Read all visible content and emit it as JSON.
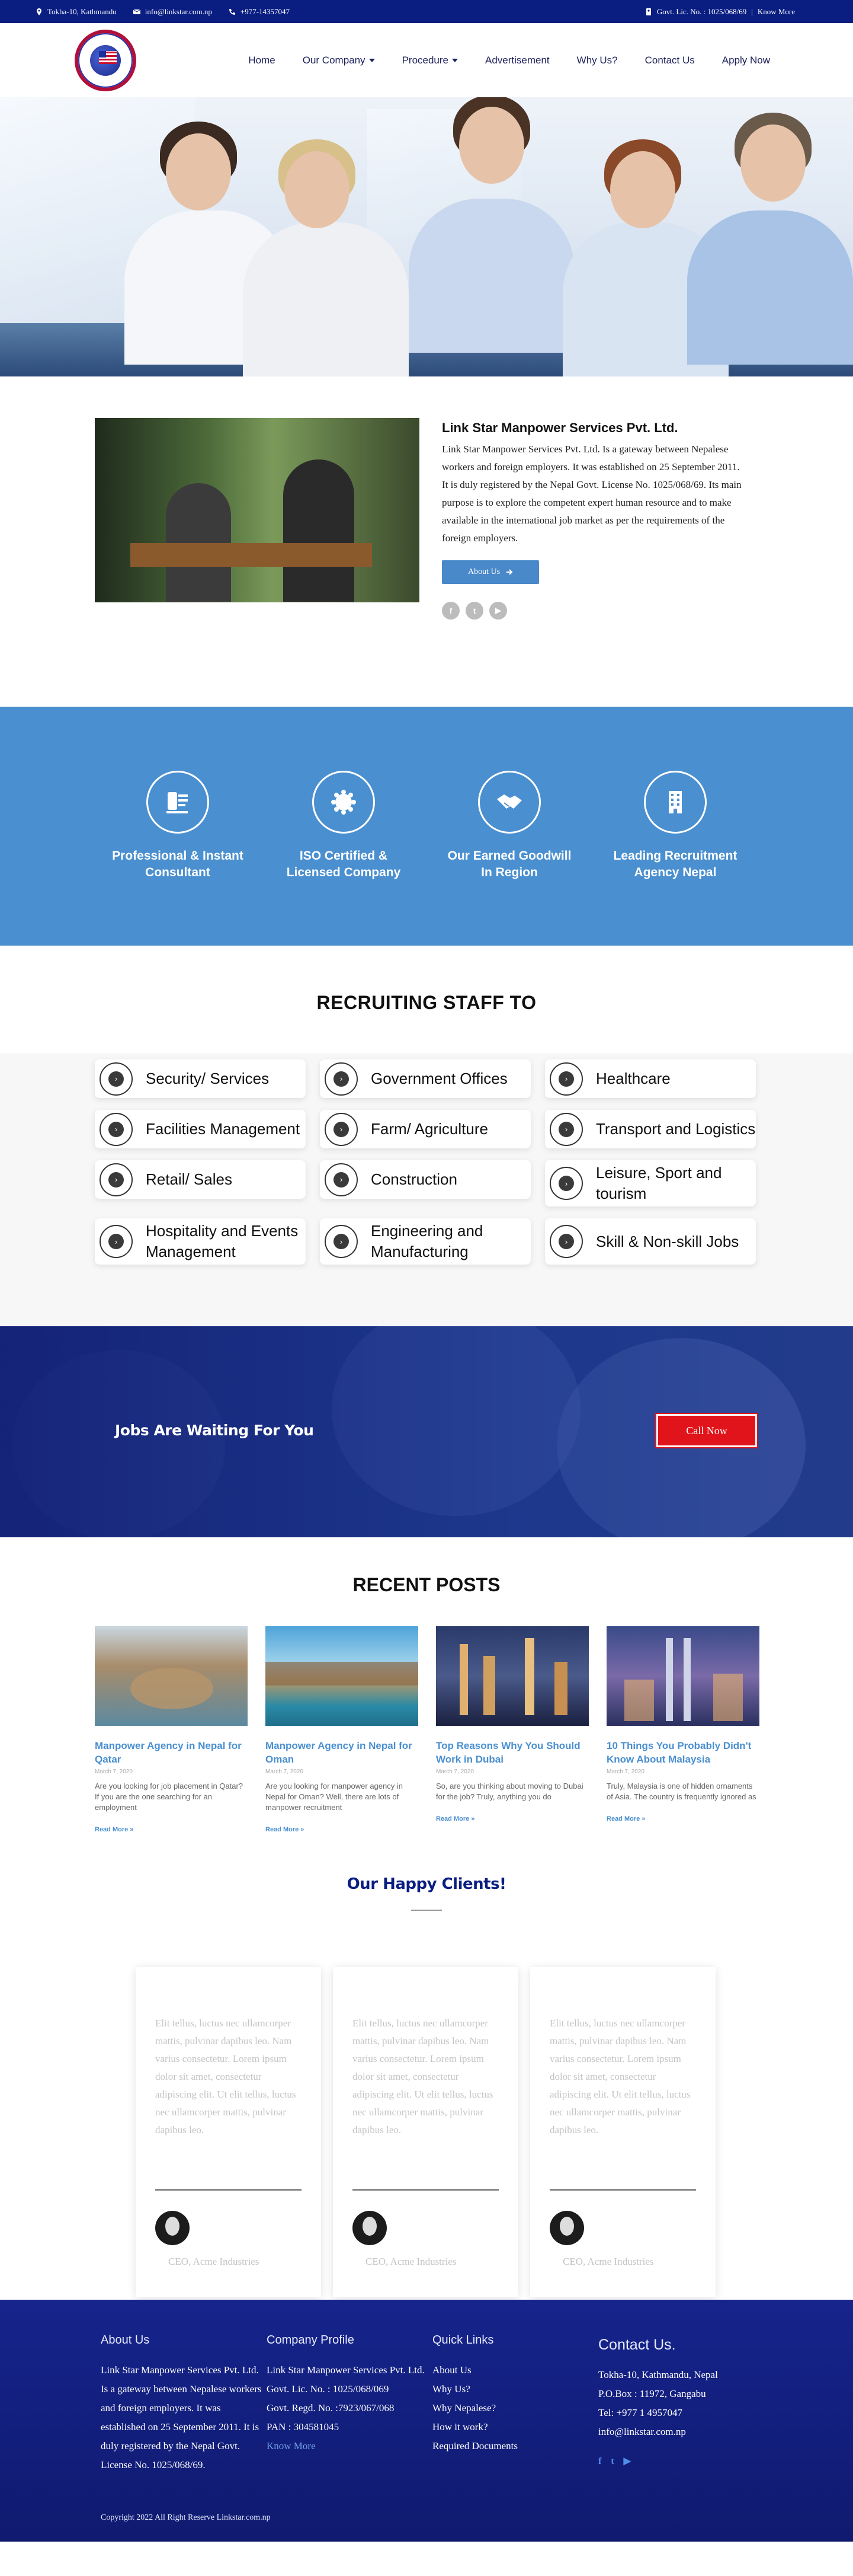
{
  "topbar": {
    "address": "Tokha-10, Kathmandu",
    "email": "info@linkstar.com.np",
    "phone": "+977-14357047",
    "license": "Govt. Lic. No. : 1025/068/69",
    "know_more": "Know More"
  },
  "nav": {
    "home": "Home",
    "company": "Our Company",
    "procedure": "Procedure",
    "advertisement": "Advertisement",
    "why_us": "Why Us?",
    "contact": "Contact Us",
    "apply": "Apply Now"
  },
  "about": {
    "title": "Link Star Manpower Services Pvt. Ltd.",
    "body": "Link Star Manpower Services Pvt. Ltd. Is a gateway between Nepalese workers and foreign employers. It was established on 25 September 2011. It is duly registered by the Nepal Govt. License No. 1025/068/69. Its main purpose is to explore the competent expert human resource and to make available in the international job market as per the requirements of the foreign employers.",
    "button": "About Us",
    "social": [
      "facebook-icon",
      "twitter-icon",
      "youtube-icon"
    ]
  },
  "features": [
    {
      "label": "Professional & Instant Consultant",
      "icon": "consultant-icon"
    },
    {
      "label": "ISO Certified & Licensed Company",
      "icon": "certificate-icon"
    },
    {
      "label": "Our Earned Goodwill In Region",
      "icon": "handshake-icon"
    },
    {
      "label": "Leading Recruitment Agency Nepal",
      "icon": "building-icon"
    }
  ],
  "recruiting": {
    "title": "RECRUITING STAFF TO",
    "items": [
      "Security/ Services",
      "Government Offices",
      "Healthcare",
      "Facilities Management",
      "Farm/ Agriculture",
      "Transport and Logistics",
      "Retail/ Sales",
      "Construction",
      "Leisure, Sport and tourism",
      "Hospitality and Events Management",
      "Engineering and Manufacturing",
      "Skill & Non-skill Jobs"
    ]
  },
  "cta": {
    "title": "Jobs Are Waiting For You",
    "button": "Call Now"
  },
  "posts": {
    "title": "RECENT POSTS",
    "items": [
      {
        "title": "Manpower Agency in Nepal for Qatar",
        "date": "March 7, 2020",
        "excerpt": "Are you looking for job placement in Qatar? If you are the one searching for an employment",
        "more": "Read More »"
      },
      {
        "title": "Manpower Agency in Nepal for Oman",
        "date": "March 7, 2020",
        "excerpt": "Are you looking for manpower agency in Nepal for Oman? Well, there are lots of manpower recruitment",
        "more": "Read More »"
      },
      {
        "title": "Top Reasons Why You Should Work in Dubai",
        "date": "March 7, 2020",
        "excerpt": "So, are you thinking about moving to Dubai for the job? Truly, anything you do",
        "more": "Read More »"
      },
      {
        "title": "10 Things You Probably Didn't Know About Malaysia",
        "date": "March 7, 2020",
        "excerpt": "Truly, Malaysia is one of hidden ornaments of Asia. The country is frequently ignored as",
        "more": "Read More »"
      }
    ]
  },
  "clients": {
    "title": "Our Happy Clients!",
    "items": [
      {
        "quote": "Elit tellus, luctus nec ullamcorper mattis, pulvinar dapibus leo. Nam varius consectetur. Lorem ipsum dolor sit amet, consectetur adipiscing elit. Ut elit tellus, luctus nec ullamcorper mattis, pulvinar dapibus leo.",
        "role": "CEO, Acme Industries"
      },
      {
        "quote": "Elit tellus, luctus nec ullamcorper mattis, pulvinar dapibus leo. Nam varius consectetur. Lorem ipsum dolor sit amet, consectetur adipiscing elit. Ut elit tellus, luctus nec ullamcorper mattis, pulvinar dapibus leo.",
        "role": "CEO, Acme Industries"
      },
      {
        "quote": "Elit tellus, luctus nec ullamcorper mattis, pulvinar dapibus leo. Nam varius consectetur. Lorem ipsum dolor sit amet, consectetur adipiscing elit. Ut elit tellus, luctus nec ullamcorper mattis, pulvinar dapibus leo.",
        "role": "CEO, Acme Industries"
      }
    ]
  },
  "footer": {
    "about_title": "About Us",
    "about_body": "Link Star Manpower Services Pvt. Ltd. Is a gateway between Nepalese workers and foreign employers. It was established on 25 September 2011. It is duly registered by the Nepal Govt. License No. 1025/068/69.",
    "profile_title": "Company Profile",
    "profile_lines": [
      "Link Star Manpower Services Pvt. Ltd.",
      "Govt. Lic. No. : 1025/068/069",
      "Govt. Regd. No. :7923/067/068",
      "PAN : 304581045"
    ],
    "profile_more": "Know More",
    "links_title": "Quick Links",
    "links": [
      "About Us",
      "Why Us?",
      "Why Nepalese?",
      "How it work?",
      "Required Documents"
    ],
    "contact_title": "Contact Us.",
    "contact_lines": [
      "Tokha-10, Kathmandu, Nepal",
      "P.O.Box : 11972, Gangabu",
      "Tel: +977 1 4957047",
      "info@linkstar.com.np"
    ],
    "social": [
      "facebook-icon",
      "twitter-icon",
      "youtube-icon"
    ],
    "copyright": "Copyright 2022 All Right Reserve Linkstar.com.np"
  },
  "colors": {
    "topbar": "#0a1e82",
    "accent": "#4a8fcf",
    "cta_button": "#e1141b",
    "footer": "#16248c"
  }
}
